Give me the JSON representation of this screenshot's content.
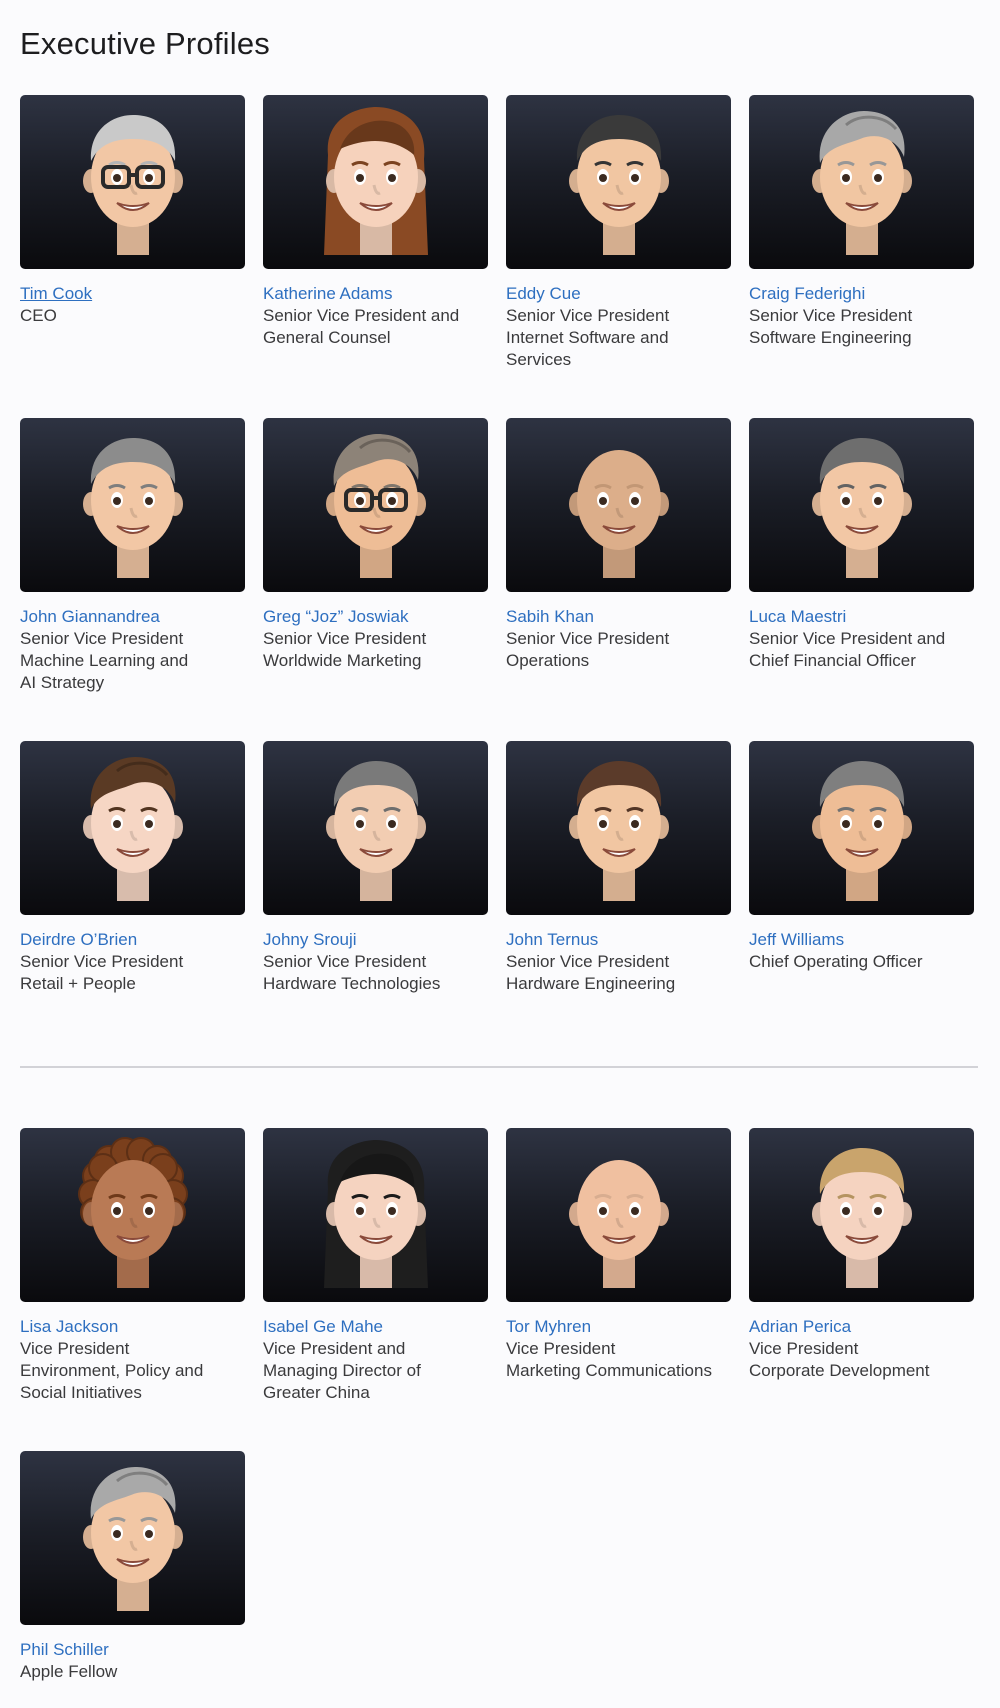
{
  "page_title": "Executive Profiles",
  "leadership": [
    {
      "name": "Tim Cook",
      "title": "CEO",
      "hair": "#c9c9c9",
      "hair_style": "short",
      "skin": "#f2c7a5",
      "glasses": true
    },
    {
      "name": "Katherine Adams",
      "title": "Senior Vice President and\nGeneral Counsel",
      "hair": "#8a4a24",
      "hair_style": "long",
      "skin": "#f6d2bc",
      "glasses": false
    },
    {
      "name": "Eddy Cue",
      "title": "Senior Vice President\nInternet Software and\nServices",
      "hair": "#3a3a3a",
      "hair_style": "short",
      "skin": "#f1c6a2",
      "glasses": false
    },
    {
      "name": "Craig Federighi",
      "title": "Senior Vice President\nSoftware Engineering",
      "hair": "#a8a8a8",
      "hair_style": "swoop",
      "skin": "#f1c6a2",
      "glasses": false
    },
    {
      "name": "John Giannandrea",
      "title": "Senior Vice President\nMachine Learning and\nAI Strategy",
      "hair": "#8c8c8c",
      "hair_style": "short",
      "skin": "#f2c7a5",
      "glasses": false
    },
    {
      "name": "Greg “Joz” Joswiak",
      "title": "Senior Vice President\nWorldwide Marketing",
      "hair": "#8d8378",
      "hair_style": "swoop",
      "skin": "#eebd96",
      "glasses": true
    },
    {
      "name": "Sabih Khan",
      "title": "Senior Vice President\nOperations",
      "hair": "#d8a882",
      "hair_style": "bald",
      "skin": "#dcae8a",
      "glasses": false
    },
    {
      "name": "Luca Maestri",
      "title": "Senior Vice President and\nChief Financial Officer",
      "hair": "#6e6e6e",
      "hair_style": "short",
      "skin": "#f2c7a5",
      "glasses": false
    },
    {
      "name": "Deirdre O’Brien",
      "title": "Senior Vice President\nRetail + People",
      "hair": "#5a3a24",
      "hair_style": "swoop",
      "skin": "#f6d6c4",
      "glasses": false
    },
    {
      "name": "Johny Srouji",
      "title": "Senior Vice President\nHardware Technologies",
      "hair": "#7a7a7a",
      "hair_style": "short",
      "skin": "#f2cdb2",
      "glasses": false
    },
    {
      "name": "John Ternus",
      "title": "Senior Vice President\nHardware Engineering",
      "hair": "#5b3b2a",
      "hair_style": "short",
      "skin": "#f1c6a2",
      "glasses": false
    },
    {
      "name": "Jeff Williams",
      "title": "Chief Operating Officer",
      "hair": "#7f7f7f",
      "hair_style": "short",
      "skin": "#eebd96",
      "glasses": false
    }
  ],
  "vice_presidents": [
    {
      "name": "Lisa Jackson",
      "title": "Vice President\nEnvironment, Policy and\nSocial Initiatives",
      "hair": "#7a3f1c",
      "hair_style": "curly",
      "skin": "#b97a55",
      "glasses": false
    },
    {
      "name": "Isabel Ge Mahe",
      "title": "Vice President and\nManaging Director of\nGreater China",
      "hair": "#1e1e1e",
      "hair_style": "long",
      "skin": "#f5d3c0",
      "glasses": false
    },
    {
      "name": "Tor Myhren",
      "title": "Vice President\nMarketing Communications",
      "hair": "#f0c0a0",
      "hair_style": "bald",
      "skin": "#f0c0a0",
      "glasses": false
    },
    {
      "name": "Adrian Perica",
      "title": "Vice President\nCorporate Development",
      "hair": "#c9a46c",
      "hair_style": "short",
      "skin": "#f5d3c0",
      "glasses": false
    },
    {
      "name": "Phil Schiller",
      "title": "Apple Fellow",
      "hair": "#a9a9a9",
      "hair_style": "swoop",
      "skin": "#f2c7a5",
      "glasses": false
    }
  ]
}
